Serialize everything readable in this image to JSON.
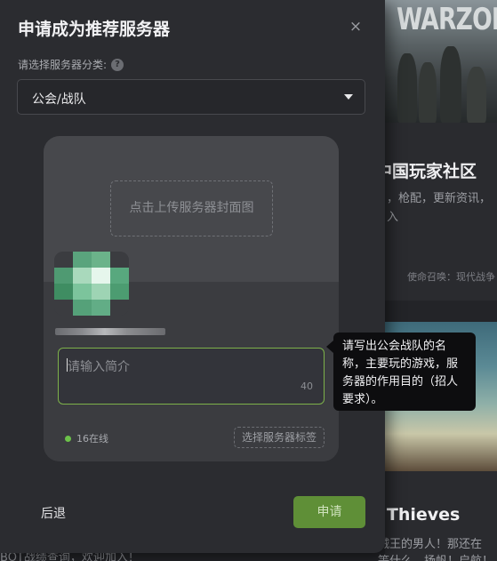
{
  "modal": {
    "title": "申请成为推荐服务器",
    "close_glyph": "×",
    "category_label": "请选择服务器分类:",
    "help_glyph": "?",
    "category_value": "公会/战队",
    "cover_upload_label": "点击上传服务器封面图",
    "intro_placeholder": "请输入简介",
    "intro_counter": "40",
    "online_text": "16在线",
    "tag_button": "选择服务器标签",
    "tooltip_lines": [
      "请写出公会战队的名",
      "称，主要玩的游戏，服",
      "务器的作用目的（招人",
      "要求）。"
    ],
    "back_button": "后退",
    "apply_button": "申请"
  },
  "background": {
    "card1": {
      "banner_text": "WARZON",
      "title": "中国玩家社区",
      "desc_line1": "，枪配，更新资讯，",
      "desc_line2": "入",
      "tag": "使命召唤：现代战争"
    },
    "card2": {
      "title": "f Thieves",
      "desc_line1": "贼王的男人！那还在",
      "desc_line2": "等什么，扬帆！启航！"
    },
    "bottom_left": "BOT战绩查询，欢迎加入！"
  },
  "colors": {
    "accent_green": "#5f8f37",
    "focus_border": "#7db14a",
    "online_dot": "#6cc24a",
    "modal_bg": "#2b2c30"
  },
  "icons": {
    "close": "close-icon",
    "help": "help-icon",
    "dropdown": "caret-down-icon",
    "online": "online-dot-icon"
  }
}
